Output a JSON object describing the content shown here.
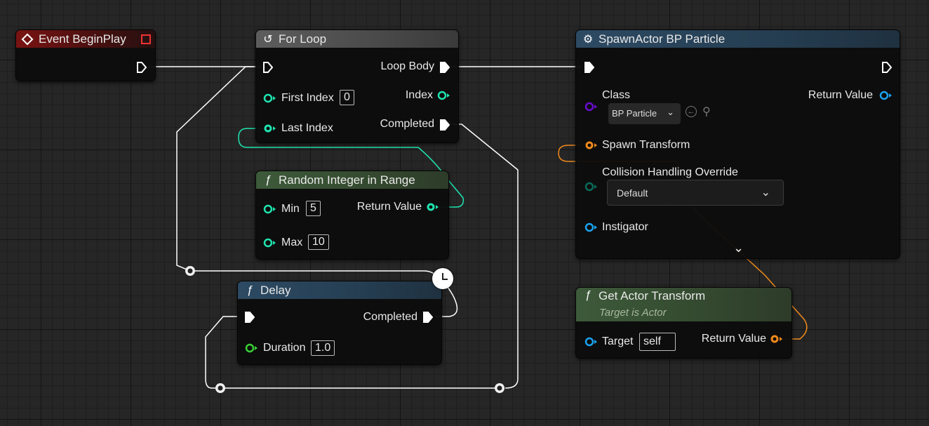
{
  "colors": {
    "exec": "#ffffff",
    "int": "#1fe3af",
    "float": "#39d135",
    "object": "#1aa3f0",
    "class": "#6a0dd0",
    "transform": "#f08a1c"
  },
  "event_begin_play": {
    "title": "Event BeginPlay",
    "icon": "event-diamond-icon"
  },
  "for_loop": {
    "title": "For Loop",
    "icon": "loop-icon",
    "first_index_label": "First Index",
    "first_index_value": "0",
    "last_index_label": "Last Index",
    "loop_body_label": "Loop Body",
    "index_label": "Index",
    "completed_label": "Completed"
  },
  "random_int": {
    "title": "Random Integer in Range",
    "icon": "function-icon",
    "min_label": "Min",
    "min_value": "5",
    "max_label": "Max",
    "max_value": "10",
    "return_label": "Return Value"
  },
  "delay": {
    "title": "Delay",
    "icon": "function-icon",
    "completed_label": "Completed",
    "duration_label": "Duration",
    "duration_value": "1.0",
    "latent_icon": "clock-icon"
  },
  "spawn_actor": {
    "title": "SpawnActor BP Particle",
    "icon": "spawn-actor-icon",
    "class_label": "Class",
    "class_value": "BP Particle",
    "return_label": "Return Value",
    "spawn_transform_label": "Spawn Transform",
    "collision_label": "Collision Handling Override",
    "collision_value": "Default",
    "instigator_label": "Instigator"
  },
  "get_actor_transform": {
    "title": "Get Actor Transform",
    "subtitle": "Target is Actor",
    "icon": "function-icon",
    "target_label": "Target",
    "target_value": "self",
    "return_label": "Return Value"
  }
}
